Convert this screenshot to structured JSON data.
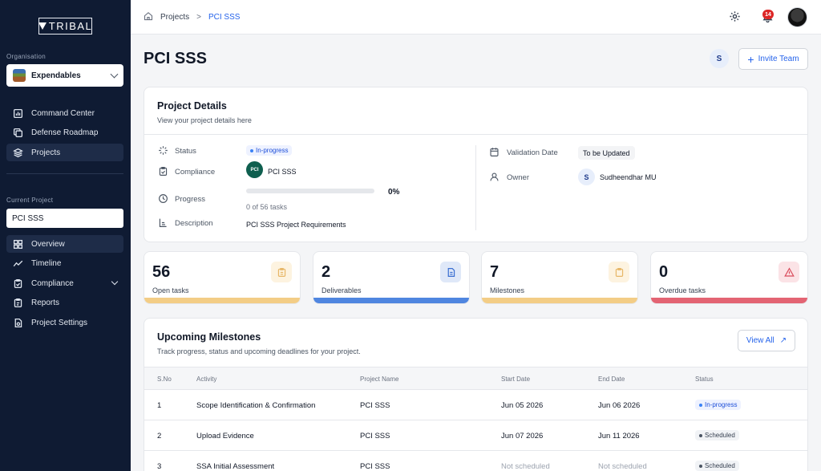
{
  "sidebar": {
    "logo": "TRIBAL",
    "org_label": "Organisation",
    "org_value": "Expendables",
    "main_nav": [
      {
        "label": "Command Center",
        "icon": "chart-box-icon"
      },
      {
        "label": "Defense Roadmap",
        "icon": "copy-icon"
      },
      {
        "label": "Projects",
        "icon": "layers-icon",
        "active": true
      }
    ],
    "current_project_label": "Current Project",
    "current_project_value": "PCI SSS",
    "project_nav": [
      {
        "label": "Overview",
        "icon": "grid-icon",
        "active": true
      },
      {
        "label": "Timeline",
        "icon": "trend-icon"
      },
      {
        "label": "Compliance",
        "icon": "clipboard-check-icon",
        "expandable": true
      },
      {
        "label": "Reports",
        "icon": "report-icon"
      },
      {
        "label": "Project Settings",
        "icon": "settings-doc-icon"
      }
    ]
  },
  "topbar": {
    "breadcrumb": [
      "Projects",
      "PCI SSS"
    ],
    "notification_count": "14"
  },
  "header": {
    "title": "PCI SSS",
    "member_initial": "S",
    "invite_label": "Invite Team"
  },
  "details": {
    "title": "Project Details",
    "subtitle": "View your project details here",
    "status_label": "Status",
    "status_value": "In-progress",
    "compliance_label": "Compliance",
    "compliance_logo_text": "PCI",
    "compliance_value": "PCI SSS",
    "progress_label": "Progress",
    "progress_percent": "0%",
    "progress_fraction": 0,
    "progress_tasks": "0 of 56 tasks",
    "description_label": "Description",
    "description_value": "PCI SSS Project Requirements",
    "validation_label": "Validation Date",
    "validation_value": "To be Updated",
    "owner_label": "Owner",
    "owner_initial": "S",
    "owner_value": "Sudheendhar MU"
  },
  "stats": [
    {
      "value": "56",
      "label": "Open tasks",
      "color": "#f3cd86",
      "icon": "clipboard-icon"
    },
    {
      "value": "2",
      "label": "Deliverables",
      "color": "#4f86e0",
      "icon": "document-icon"
    },
    {
      "value": "7",
      "label": "Milestones",
      "color": "#f3cd86",
      "icon": "clipboard-icon"
    },
    {
      "value": "0",
      "label": "Overdue tasks",
      "color": "#e36473",
      "icon": "warning-icon"
    }
  ],
  "milestones": {
    "title": "Upcoming Milestones",
    "subtitle": "Track progress, status and upcoming deadlines for your project.",
    "view_all_label": "View All",
    "columns": [
      "S.No",
      "Activity",
      "Project Name",
      "Start Date",
      "End Date",
      "Status"
    ],
    "rows": [
      {
        "sno": "1",
        "activity": "Scope Identification & Confirmation",
        "project": "PCI SSS",
        "start": "Jun 05 2026",
        "end": "Jun 06 2026",
        "status": "In-progress"
      },
      {
        "sno": "2",
        "activity": "Upload Evidence",
        "project": "PCI SSS",
        "start": "Jun 07 2026",
        "end": "Jun 11 2026",
        "status": "Scheduled"
      },
      {
        "sno": "3",
        "activity": "SSA Initial Assessment",
        "project": "PCI SSS",
        "start": "Not scheduled",
        "end": "Not scheduled",
        "status": "Scheduled"
      }
    ]
  }
}
